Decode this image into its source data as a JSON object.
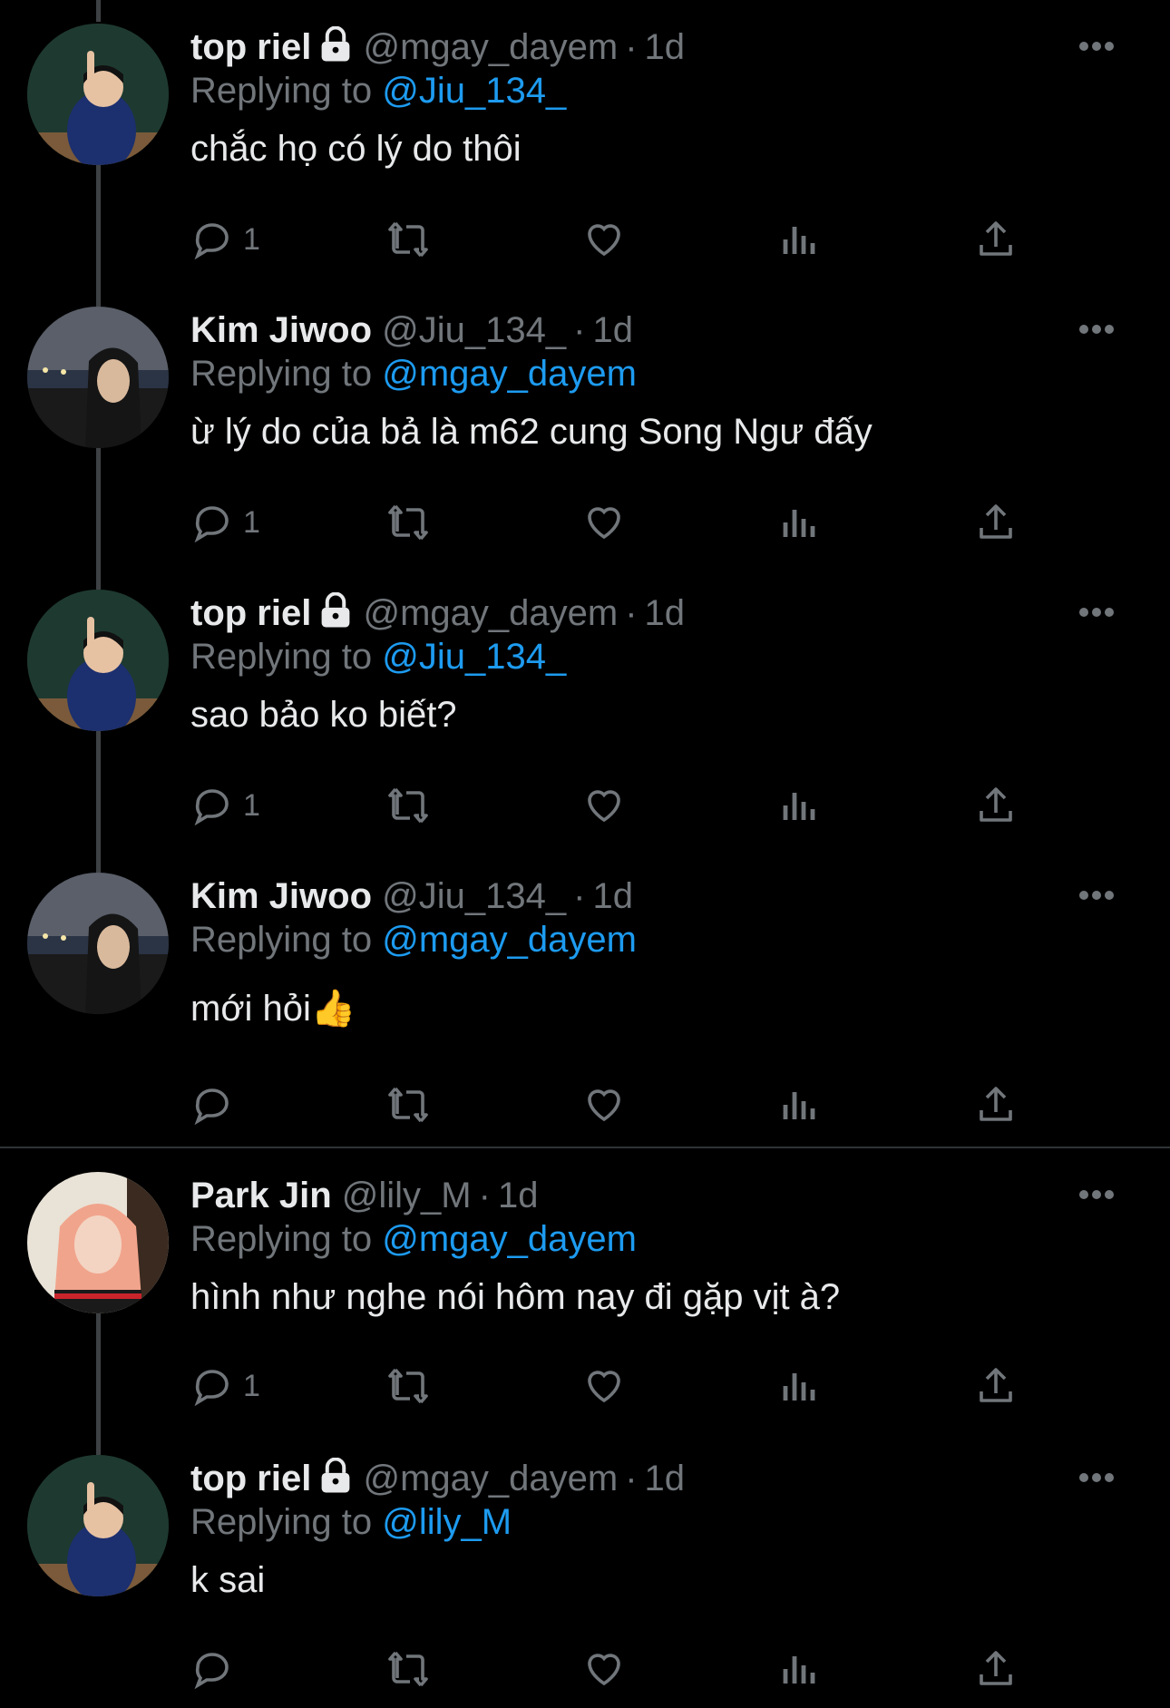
{
  "tweets": [
    {
      "name": "top riel",
      "locked": true,
      "handle": "@mgay_dayem",
      "time": "1d",
      "replying_prefix": "Replying to",
      "replying_to": "@Jiu_134_",
      "text": "chắc họ có lý do thôi",
      "replies": "1"
    },
    {
      "name": "Kim Jiwoo",
      "locked": false,
      "handle": "@Jiu_134_",
      "time": "1d",
      "replying_prefix": "Replying to",
      "replying_to": "@mgay_dayem",
      "text": "ừ lý do của bả là m62 cung Song Ngư đấy",
      "replies": "1"
    },
    {
      "name": "top riel",
      "locked": true,
      "handle": "@mgay_dayem",
      "time": "1d",
      "replying_prefix": "Replying to",
      "replying_to": "@Jiu_134_",
      "text": "sao bảo ko biết?",
      "replies": "1"
    },
    {
      "name": "Kim Jiwoo",
      "locked": false,
      "handle": "@Jiu_134_",
      "time": "1d",
      "replying_prefix": "Replying to",
      "replying_to": "@mgay_dayem",
      "text": "mới hỏi👍",
      "replies": ""
    },
    {
      "name": "Park Jin",
      "locked": false,
      "handle": "@lily_M",
      "time": "1d",
      "replying_prefix": "Replying to",
      "replying_to": "@mgay_dayem",
      "text": "hình như nghe nói hôm nay đi gặp vịt à?",
      "replies": "1"
    },
    {
      "name": "top riel",
      "locked": true,
      "handle": "@mgay_dayem",
      "time": "1d",
      "replying_prefix": "Replying to",
      "replying_to": "@lily_M",
      "text": "k sai",
      "replies": ""
    }
  ],
  "icons": {
    "reply": "reply-icon",
    "retweet": "retweet-icon",
    "like": "heart-icon",
    "views": "views-icon",
    "share": "share-icon",
    "more": "more-icon",
    "lock": "lock-icon"
  },
  "colors": {
    "background": "#000000",
    "text": "#e7e9ea",
    "muted": "#71767b",
    "link": "#1d9bf0"
  }
}
